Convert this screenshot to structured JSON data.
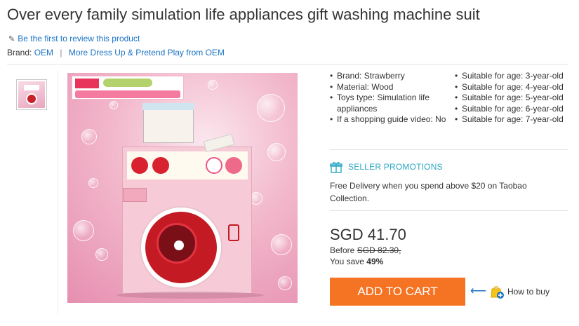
{
  "product": {
    "title": "Over every family simulation life appliances gift washing machine suit",
    "review_link": "Be the first to review this product",
    "brand_label": "Brand:",
    "brand_value": "OEM",
    "brand_more": "More Dress Up & Pretend Play from OEM"
  },
  "specs": {
    "left": [
      "Brand: Strawberry",
      "Material: Wood",
      "Toys type: Simulation life appliances",
      "If a shopping guide video: No"
    ],
    "right": [
      "Suitable for age: 3-year-old",
      "Suitable for age: 4-year-old",
      "Suitable for age: 5-year-old",
      "Suitable for age: 6-year-old",
      "Suitable for age: 7-year-old"
    ]
  },
  "promotions": {
    "heading": "SELLER PROMOTIONS",
    "text": "Free Delivery when you spend above $20 on Taobao Collection."
  },
  "pricing": {
    "price": "SGD 41.70",
    "before_label": "Before",
    "before_value": "SGD 82.30,",
    "save_label": "You save",
    "save_value": "49%"
  },
  "actions": {
    "add_to_cart": "ADD TO CART",
    "how_to_buy": "How to buy"
  },
  "colors": {
    "link": "#1a73c6",
    "cart_button": "#f47424",
    "promo_accent": "#2aa9c4"
  },
  "icons": {
    "review": "pencil-icon",
    "promotion": "gift-icon",
    "how_to_buy": "shopping-bag-icon"
  }
}
